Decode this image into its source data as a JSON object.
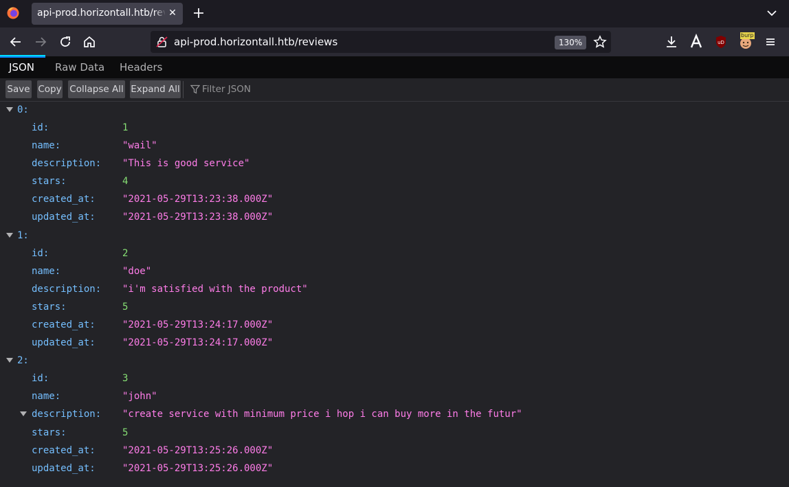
{
  "browser": {
    "tab_title": "api-prod.horizontall.htb/reviews",
    "url": "api-prod.horizontall.htb/reviews",
    "zoom": "130%",
    "extension_label": "burp"
  },
  "viewer": {
    "tabs": [
      "JSON",
      "Raw Data",
      "Headers"
    ],
    "toolbar": {
      "save": "Save",
      "copy": "Copy",
      "collapse_all": "Collapse All",
      "expand_all": "Expand All",
      "filter_placeholder": "Filter JSON"
    }
  },
  "records": [
    {
      "index": "0:",
      "fields": [
        {
          "key": "id:",
          "value": "1",
          "type": "num"
        },
        {
          "key": "name:",
          "value": "\"wail\"",
          "type": "str"
        },
        {
          "key": "description:",
          "value": "\"This is good service\"",
          "type": "str"
        },
        {
          "key": "stars:",
          "value": "4",
          "type": "num"
        },
        {
          "key": "created_at:",
          "value": "\"2021-05-29T13:23:38.000Z\"",
          "type": "str"
        },
        {
          "key": "updated_at:",
          "value": "\"2021-05-29T13:23:38.000Z\"",
          "type": "str"
        }
      ]
    },
    {
      "index": "1:",
      "fields": [
        {
          "key": "id:",
          "value": "2",
          "type": "num"
        },
        {
          "key": "name:",
          "value": "\"doe\"",
          "type": "str"
        },
        {
          "key": "description:",
          "value": "\"i'm satisfied with the product\"",
          "type": "str"
        },
        {
          "key": "stars:",
          "value": "5",
          "type": "num"
        },
        {
          "key": "created_at:",
          "value": "\"2021-05-29T13:24:17.000Z\"",
          "type": "str"
        },
        {
          "key": "updated_at:",
          "value": "\"2021-05-29T13:24:17.000Z\"",
          "type": "str"
        }
      ]
    },
    {
      "index": "2:",
      "fields": [
        {
          "key": "id:",
          "value": "3",
          "type": "num"
        },
        {
          "key": "name:",
          "value": "\"john\"",
          "type": "str"
        },
        {
          "key": "description:",
          "value": "\"create service with minimum price i hop i can buy more in the futur\"",
          "type": "str",
          "expandable": true
        },
        {
          "key": "stars:",
          "value": "5",
          "type": "num"
        },
        {
          "key": "created_at:",
          "value": "\"2021-05-29T13:25:26.000Z\"",
          "type": "str"
        },
        {
          "key": "updated_at:",
          "value": "\"2021-05-29T13:25:26.000Z\"",
          "type": "str"
        }
      ]
    }
  ],
  "colors": {
    "key": "#75bfff",
    "string": "#ff7de9",
    "number": "#86de74",
    "accent": "#00ddff"
  }
}
